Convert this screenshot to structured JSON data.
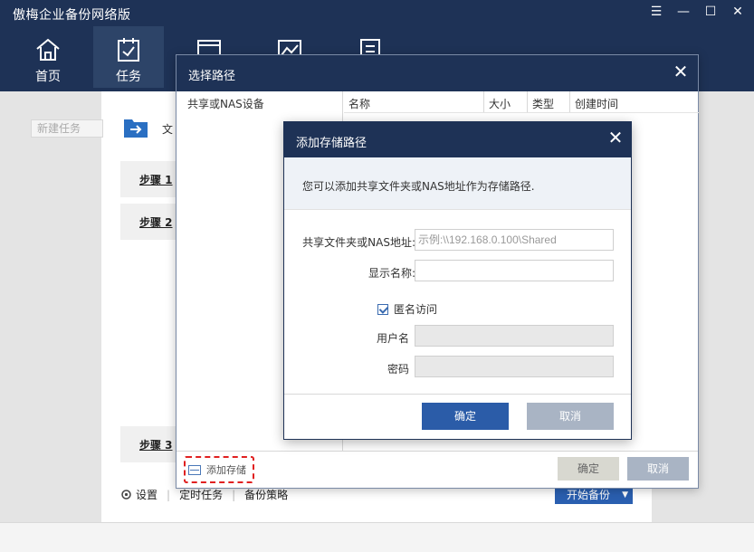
{
  "app": {
    "title": "傲梅企业备份网络版",
    "window_controls": [
      "☰",
      "—",
      "☐",
      "✕"
    ]
  },
  "nav": {
    "items": [
      {
        "label": "首页",
        "icon": "home-icon",
        "active": false
      },
      {
        "label": "任务",
        "icon": "task-check-icon",
        "active": true
      },
      {
        "label": "",
        "icon": "window-icon",
        "active": false
      },
      {
        "label": "",
        "icon": "chart-icon",
        "active": false
      },
      {
        "label": "",
        "icon": "list-icon",
        "active": false
      }
    ]
  },
  "background": {
    "new_task_placeholder": "新建任务",
    "file_label": "文",
    "steps": [
      "步骤 1",
      "步骤 2",
      "步骤 3"
    ],
    "settings_label": "设置",
    "scheduled_task_label": "定时任务",
    "backup_strategy_label": "备份策略",
    "start_backup_label": "开始备份"
  },
  "select_path_dialog": {
    "title": "选择路径",
    "left_header": "共享或NAS设备",
    "columns": [
      "名称",
      "大小",
      "类型",
      "创建时间"
    ],
    "add_storage_label": "添加存储",
    "ok_label": "确定",
    "cancel_label": "取消"
  },
  "add_storage_dialog": {
    "title": "添加存储路径",
    "info_text": "您可以添加共享文件夹或NAS地址作为存储路径.",
    "share_label": "共享文件夹或NAS地址:",
    "share_placeholder": "示例:\\\\192.168.0.100\\Shared",
    "display_name_label": "显示名称:",
    "display_name_value": "",
    "anonymous_label": "匿名访问",
    "anonymous_checked": true,
    "username_label": "用户名",
    "password_label": "密码",
    "ok_label": "确定",
    "cancel_label": "取消"
  },
  "colors": {
    "header_bg": "#1e3256",
    "primary_button": "#2b5ca8",
    "secondary_button": "#a9b4c4",
    "highlight_dashed": "#e02020"
  }
}
